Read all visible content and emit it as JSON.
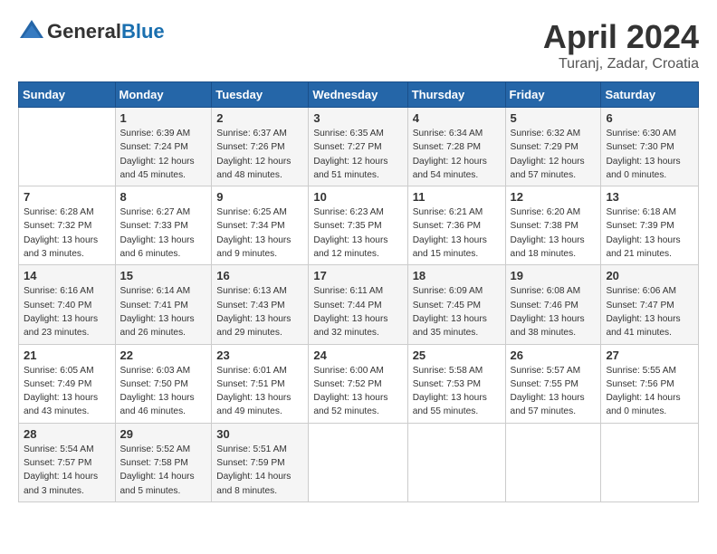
{
  "header": {
    "logo_general": "General",
    "logo_blue": "Blue",
    "title": "April 2024",
    "location": "Turanj, Zadar, Croatia"
  },
  "days_of_week": [
    "Sunday",
    "Monday",
    "Tuesday",
    "Wednesday",
    "Thursday",
    "Friday",
    "Saturday"
  ],
  "weeks": [
    [
      {
        "day": "",
        "detail": ""
      },
      {
        "day": "1",
        "detail": "Sunrise: 6:39 AM\nSunset: 7:24 PM\nDaylight: 12 hours\nand 45 minutes."
      },
      {
        "day": "2",
        "detail": "Sunrise: 6:37 AM\nSunset: 7:26 PM\nDaylight: 12 hours\nand 48 minutes."
      },
      {
        "day": "3",
        "detail": "Sunrise: 6:35 AM\nSunset: 7:27 PM\nDaylight: 12 hours\nand 51 minutes."
      },
      {
        "day": "4",
        "detail": "Sunrise: 6:34 AM\nSunset: 7:28 PM\nDaylight: 12 hours\nand 54 minutes."
      },
      {
        "day": "5",
        "detail": "Sunrise: 6:32 AM\nSunset: 7:29 PM\nDaylight: 12 hours\nand 57 minutes."
      },
      {
        "day": "6",
        "detail": "Sunrise: 6:30 AM\nSunset: 7:30 PM\nDaylight: 13 hours\nand 0 minutes."
      }
    ],
    [
      {
        "day": "7",
        "detail": "Sunrise: 6:28 AM\nSunset: 7:32 PM\nDaylight: 13 hours\nand 3 minutes."
      },
      {
        "day": "8",
        "detail": "Sunrise: 6:27 AM\nSunset: 7:33 PM\nDaylight: 13 hours\nand 6 minutes."
      },
      {
        "day": "9",
        "detail": "Sunrise: 6:25 AM\nSunset: 7:34 PM\nDaylight: 13 hours\nand 9 minutes."
      },
      {
        "day": "10",
        "detail": "Sunrise: 6:23 AM\nSunset: 7:35 PM\nDaylight: 13 hours\nand 12 minutes."
      },
      {
        "day": "11",
        "detail": "Sunrise: 6:21 AM\nSunset: 7:36 PM\nDaylight: 13 hours\nand 15 minutes."
      },
      {
        "day": "12",
        "detail": "Sunrise: 6:20 AM\nSunset: 7:38 PM\nDaylight: 13 hours\nand 18 minutes."
      },
      {
        "day": "13",
        "detail": "Sunrise: 6:18 AM\nSunset: 7:39 PM\nDaylight: 13 hours\nand 21 minutes."
      }
    ],
    [
      {
        "day": "14",
        "detail": "Sunrise: 6:16 AM\nSunset: 7:40 PM\nDaylight: 13 hours\nand 23 minutes."
      },
      {
        "day": "15",
        "detail": "Sunrise: 6:14 AM\nSunset: 7:41 PM\nDaylight: 13 hours\nand 26 minutes."
      },
      {
        "day": "16",
        "detail": "Sunrise: 6:13 AM\nSunset: 7:43 PM\nDaylight: 13 hours\nand 29 minutes."
      },
      {
        "day": "17",
        "detail": "Sunrise: 6:11 AM\nSunset: 7:44 PM\nDaylight: 13 hours\nand 32 minutes."
      },
      {
        "day": "18",
        "detail": "Sunrise: 6:09 AM\nSunset: 7:45 PM\nDaylight: 13 hours\nand 35 minutes."
      },
      {
        "day": "19",
        "detail": "Sunrise: 6:08 AM\nSunset: 7:46 PM\nDaylight: 13 hours\nand 38 minutes."
      },
      {
        "day": "20",
        "detail": "Sunrise: 6:06 AM\nSunset: 7:47 PM\nDaylight: 13 hours\nand 41 minutes."
      }
    ],
    [
      {
        "day": "21",
        "detail": "Sunrise: 6:05 AM\nSunset: 7:49 PM\nDaylight: 13 hours\nand 43 minutes."
      },
      {
        "day": "22",
        "detail": "Sunrise: 6:03 AM\nSunset: 7:50 PM\nDaylight: 13 hours\nand 46 minutes."
      },
      {
        "day": "23",
        "detail": "Sunrise: 6:01 AM\nSunset: 7:51 PM\nDaylight: 13 hours\nand 49 minutes."
      },
      {
        "day": "24",
        "detail": "Sunrise: 6:00 AM\nSunset: 7:52 PM\nDaylight: 13 hours\nand 52 minutes."
      },
      {
        "day": "25",
        "detail": "Sunrise: 5:58 AM\nSunset: 7:53 PM\nDaylight: 13 hours\nand 55 minutes."
      },
      {
        "day": "26",
        "detail": "Sunrise: 5:57 AM\nSunset: 7:55 PM\nDaylight: 13 hours\nand 57 minutes."
      },
      {
        "day": "27",
        "detail": "Sunrise: 5:55 AM\nSunset: 7:56 PM\nDaylight: 14 hours\nand 0 minutes."
      }
    ],
    [
      {
        "day": "28",
        "detail": "Sunrise: 5:54 AM\nSunset: 7:57 PM\nDaylight: 14 hours\nand 3 minutes."
      },
      {
        "day": "29",
        "detail": "Sunrise: 5:52 AM\nSunset: 7:58 PM\nDaylight: 14 hours\nand 5 minutes."
      },
      {
        "day": "30",
        "detail": "Sunrise: 5:51 AM\nSunset: 7:59 PM\nDaylight: 14 hours\nand 8 minutes."
      },
      {
        "day": "",
        "detail": ""
      },
      {
        "day": "",
        "detail": ""
      },
      {
        "day": "",
        "detail": ""
      },
      {
        "day": "",
        "detail": ""
      }
    ]
  ]
}
